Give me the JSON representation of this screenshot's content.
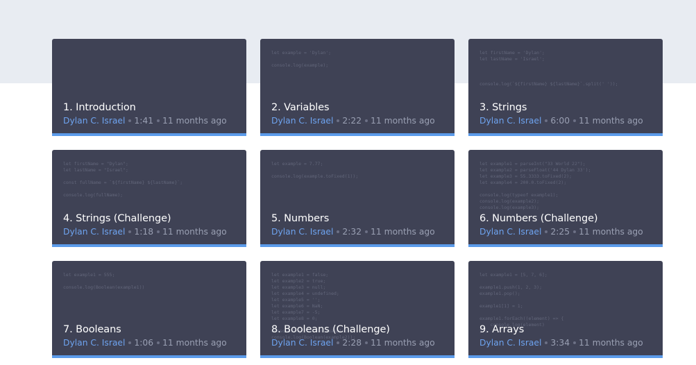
{
  "videos": [
    {
      "title": "1. Introduction",
      "author": "Dylan C. Israel",
      "duration": "1:41",
      "age": "11 months ago",
      "code": ""
    },
    {
      "title": "2. Variables",
      "author": "Dylan C. Israel",
      "duration": "2:22",
      "age": "11 months ago",
      "code": "let example = 'Dylan';\n\nconsole.log(example);"
    },
    {
      "title": "3. Strings",
      "author": "Dylan C. Israel",
      "duration": "6:00",
      "age": "11 months ago",
      "code": "let firstName = 'Dylan';\nlet lastName = 'Israel';\n\n\n\nconsole.log(`${firstName} ${lastName}`.split(' '));"
    },
    {
      "title": "4. Strings (Challenge)",
      "author": "Dylan C. Israel",
      "duration": "1:18",
      "age": "11 months ago",
      "code": "let firstName = \"Dylan\";\nlet lastName = \"Israel\";\n\nconst fullName = `${firstName} ${lastName}`;\n\nconsole.log(fullName);"
    },
    {
      "title": "5. Numbers",
      "author": "Dylan C. Israel",
      "duration": "2:32",
      "age": "11 months ago",
      "code": "let example = 7.77;\n\nconsole.log(example.toFixed(1));"
    },
    {
      "title": "6. Numbers (Challenge)",
      "author": "Dylan C. Israel",
      "duration": "2:25",
      "age": "11 months ago",
      "code": "let example1 = parseInt(\"33 World 22\");\nlet example2 = parseFloat('44 Dylan 33');\nlet example3 = 55.3333.toFixed(2);\nlet example4 = 200.0.toFixed(2);\n\nconsole.log(typeof example1);\nconsole.log(example2);\nconsole.log(example3);"
    },
    {
      "title": "7. Booleans",
      "author": "Dylan C. Israel",
      "duration": "1:06",
      "age": "11 months ago",
      "code": "let example1 = 555;\n\nconsole.log(Boolean(example1))"
    },
    {
      "title": "8. Booleans (Challenge)",
      "author": "Dylan C. Israel",
      "duration": "2:28",
      "age": "11 months ago",
      "code": "let example1 = false;\nlet example2 = true;\nlet example3 = null;\nlet example4 = undefined;\nlet example5 = '';\nlet example6 = NaN;\nlet example7 = -5;\nlet example8 = 0;\n\nconsole.log(Boolean(example1));\nconsole.log(Boolean(example2));"
    },
    {
      "title": "9. Arrays",
      "author": "Dylan C. Israel",
      "duration": "3:34",
      "age": "11 months ago",
      "code": "let example1 = [5, 7, 6];\n\nexample1.push(1, 2, 3);\nexample1.pop();\n\nexample1[1] = 1;\n\nexample1.forEach((element) => {\n    console.log(element)\n});"
    }
  ]
}
